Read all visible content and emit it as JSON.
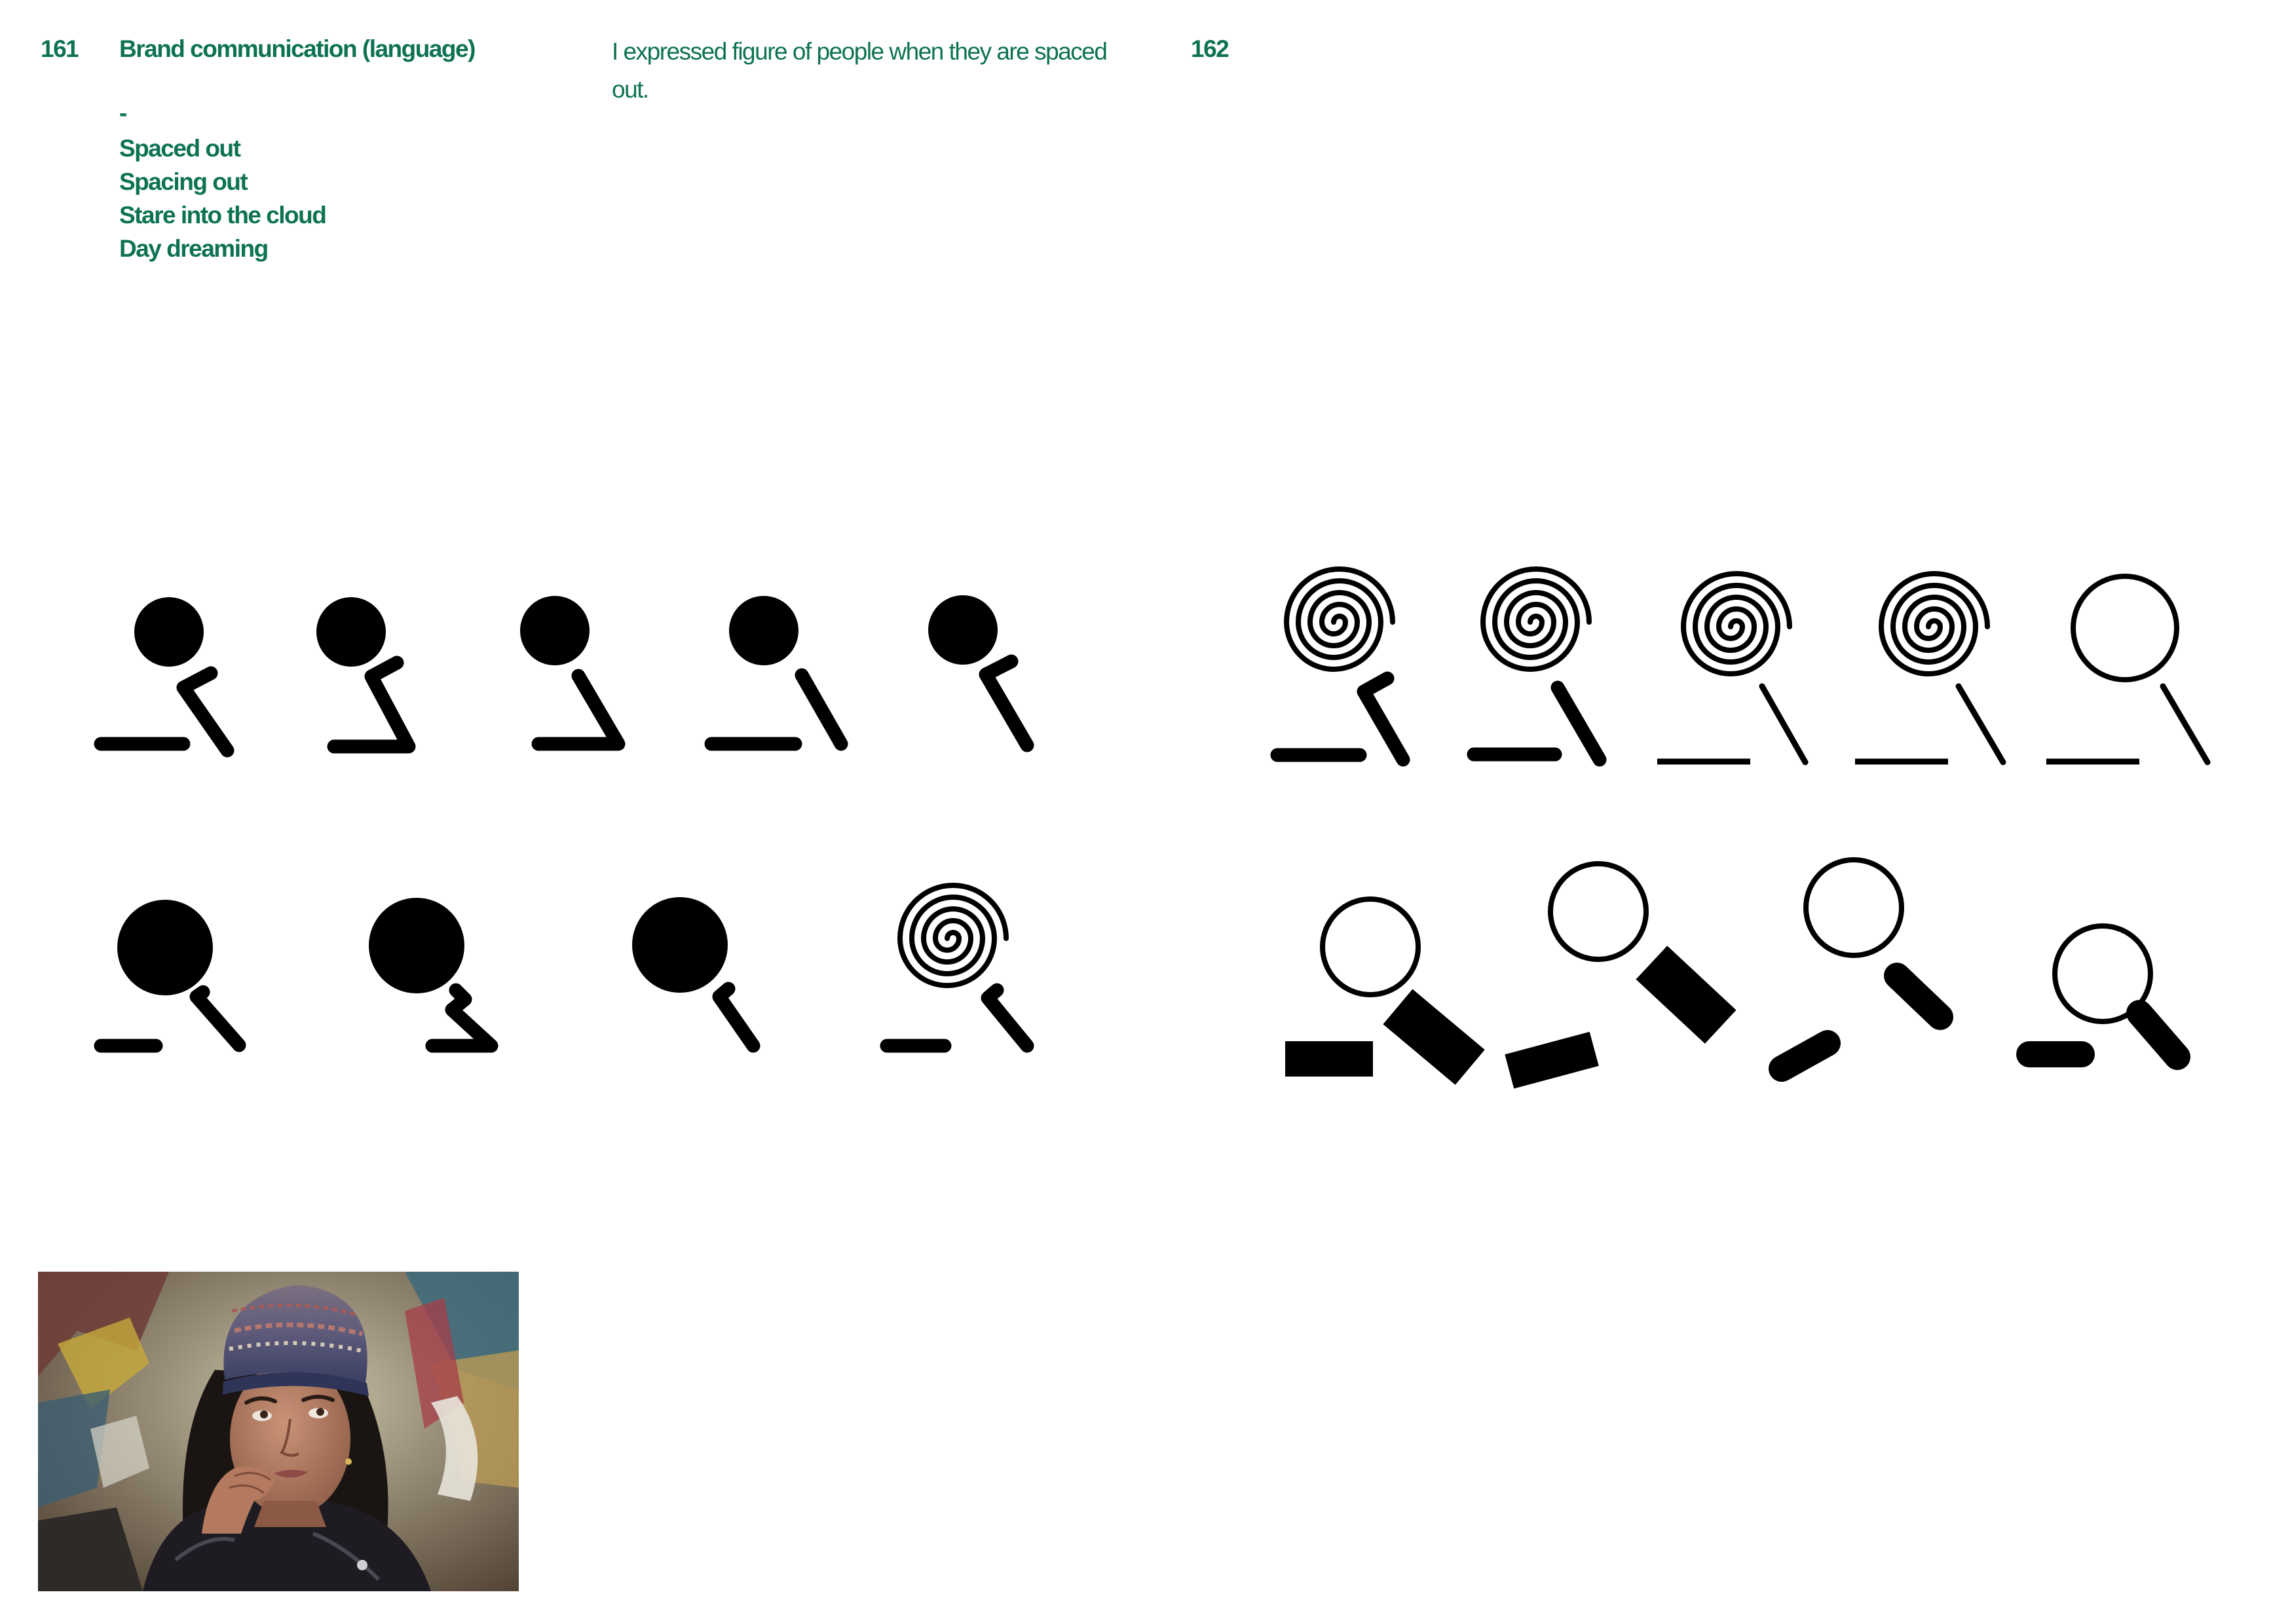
{
  "page": {
    "left_number": "161",
    "right_number": "162",
    "heading": "Brand communication (language)",
    "dash": "-",
    "keywords": [
      "Spaced out",
      "Spacing out",
      "Stare into the cloud",
      "Day dreaming"
    ],
    "description": "I expressed figure of people when they are spaced out."
  },
  "colors": {
    "text": "#0d7253",
    "figure": "#000000",
    "background": "#ffffff"
  },
  "figures": {
    "rows": 4,
    "total": 18,
    "head_styles": [
      "solid-circle",
      "spiral",
      "outline-circle"
    ]
  },
  "photo": {
    "subject": "woman in knit beanie resting chin on hand"
  }
}
